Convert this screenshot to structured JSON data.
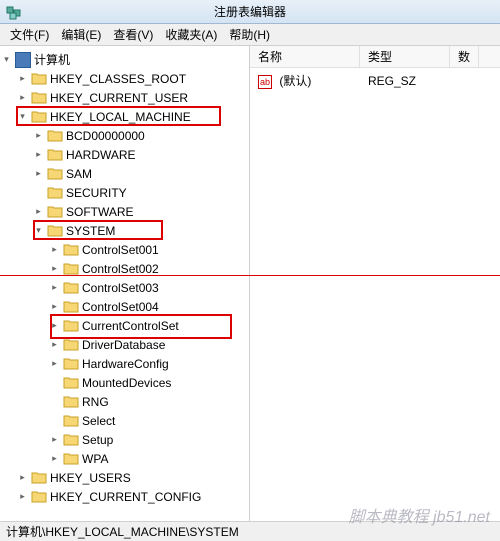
{
  "window": {
    "title": "注册表编辑器"
  },
  "menu": {
    "file": "文件(F)",
    "edit": "编辑(E)",
    "view": "查看(V)",
    "favorites": "收藏夹(A)",
    "help": "帮助(H)"
  },
  "list": {
    "headers": {
      "name": "名称",
      "type": "类型",
      "data_col": "数"
    },
    "row": {
      "name": "(默认)",
      "type": "REG_SZ",
      "icon_text": "ab"
    }
  },
  "tree": {
    "root": "计算机",
    "hkcr": "HKEY_CLASSES_ROOT",
    "hkcu": "HKEY_CURRENT_USER",
    "hklm": "HKEY_LOCAL_MACHINE",
    "bcd": "BCD00000000",
    "hardware": "HARDWARE",
    "sam": "SAM",
    "security": "SECURITY",
    "software": "SOFTWARE",
    "system": "SYSTEM",
    "cs001": "ControlSet001",
    "cs002": "ControlSet002",
    "cs003": "ControlSet003",
    "cs004": "ControlSet004",
    "ccs": "CurrentControlSet",
    "driverdb": "DriverDatabase",
    "hwconfig": "HardwareConfig",
    "mounted": "MountedDevices",
    "rng": "RNG",
    "select": "Select",
    "setup": "Setup",
    "wpa": "WPA",
    "hku": "HKEY_USERS",
    "hkcc": "HKEY_CURRENT_CONFIG"
  },
  "status": {
    "path": "计算机\\HKEY_LOCAL_MACHINE\\SYSTEM"
  },
  "watermark": "脚本典教程 jb51.net"
}
